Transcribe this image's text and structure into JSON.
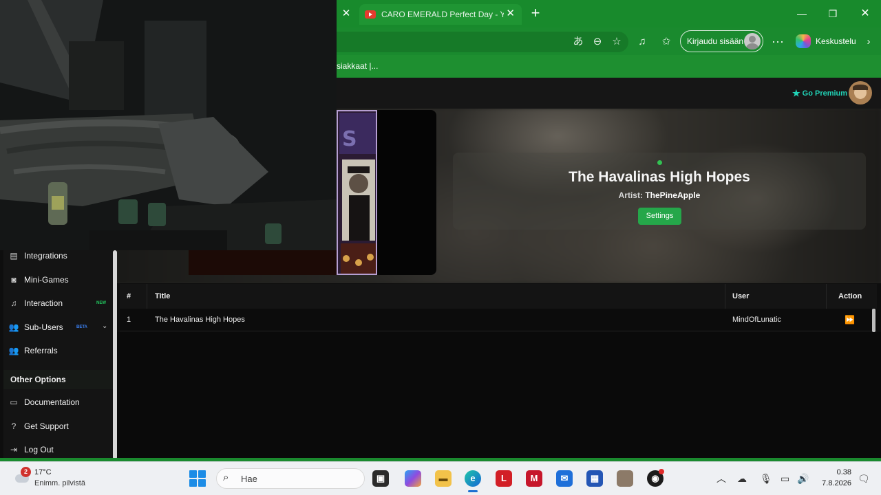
{
  "browser": {
    "tabs": [
      {
        "title": "CARO EMERALD Perfect Day - You",
        "favicon": "youtube-icon"
      }
    ],
    "favorites": [
      "siakkaat |..."
    ],
    "signin_label": "Kirjaudu sisään",
    "copilot_label": "Keskustelu"
  },
  "page": {
    "premium_label": "Go Premium",
    "sidebar": {
      "items": [
        {
          "label": "Integrations",
          "icon": "integrations-icon"
        },
        {
          "label": "Mini-Games",
          "icon": "gamepad-icon"
        },
        {
          "label": "Interaction",
          "icon": "music-icon",
          "badge": "NEW"
        },
        {
          "label": "Sub-Users",
          "icon": "users-icon",
          "badge": "BETA"
        },
        {
          "label": "Referrals",
          "icon": "referrals-icon"
        }
      ],
      "section_title": "Other Options",
      "other_items": [
        {
          "label": "Documentation",
          "icon": "document-icon"
        },
        {
          "label": "Get Support",
          "icon": "help-icon"
        },
        {
          "label": "Log Out",
          "icon": "logout-icon"
        }
      ]
    },
    "now_playing": {
      "title": "The Havalinas High Hopes",
      "artist_label": "Artist:",
      "artist": "ThePineApple",
      "settings_label": "Settings"
    },
    "queue": {
      "columns": [
        "#",
        "Title",
        "User",
        "Action"
      ],
      "rows": [
        {
          "num": "1",
          "title": "The Havalinas High Hopes",
          "user": "MindOfLunatic"
        }
      ]
    }
  },
  "taskbar": {
    "weather_badge": "2",
    "weather_temp": "17°C",
    "weather_desc": "Enimm. pilvistä",
    "search_placeholder": "Hae",
    "time": "0.38",
    "date": "7.8.2026"
  },
  "colors": {
    "browser_green": "#188a2c",
    "accent_teal": "#21d3b7",
    "settings_green": "#25a74a",
    "badge_new": "#22c55e",
    "badge_beta": "#3b82f6"
  }
}
